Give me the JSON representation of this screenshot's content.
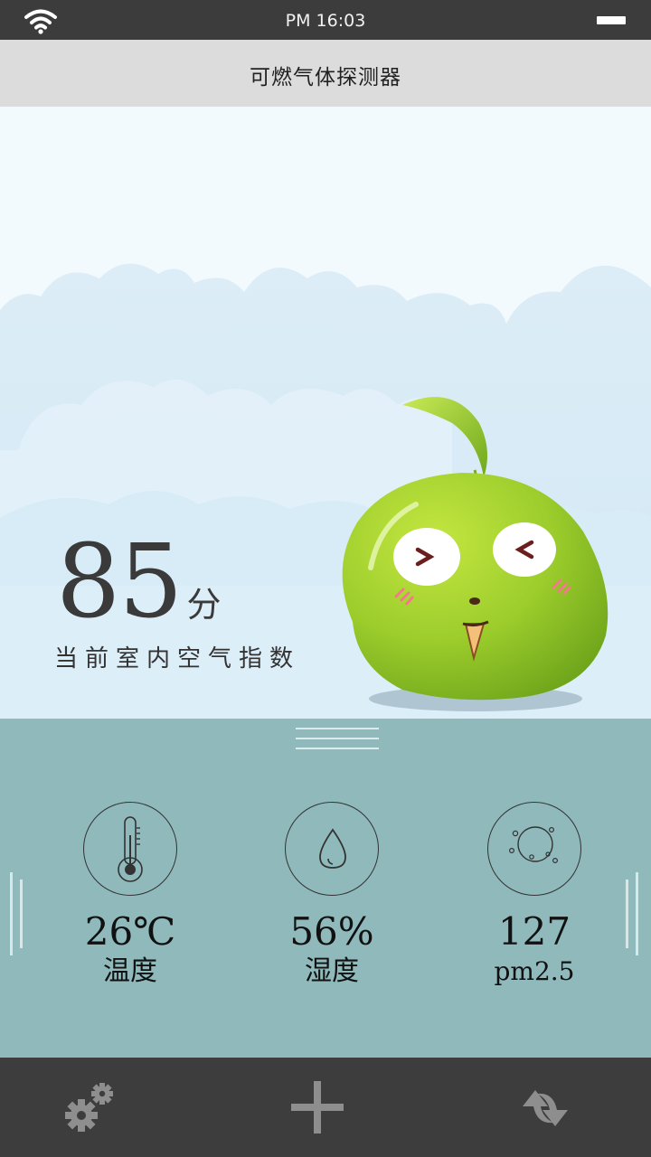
{
  "status_bar": {
    "time": "PM 16:03"
  },
  "header": {
    "title": "可燃气体探测器"
  },
  "score": {
    "value": "85",
    "unit": "分",
    "label": "当前室内空气指数"
  },
  "stats": [
    {
      "value": "26℃",
      "label": "温度",
      "icon": "thermometer-icon"
    },
    {
      "value": "56%",
      "label": "湿度",
      "icon": "water-drop-icon"
    },
    {
      "value": "127",
      "label": "pm2.5",
      "icon": "particles-icon"
    }
  ],
  "tabbar": {
    "icons": [
      "settings-gears-icon",
      "add-icon",
      "refresh-arrows-icon"
    ]
  },
  "colors": {
    "panel": "#8fb9bb",
    "sky": "#f2fafd",
    "cloud": "#d6ebf6",
    "mascot": "#9ed12f",
    "bar": "#3d3d3d"
  }
}
